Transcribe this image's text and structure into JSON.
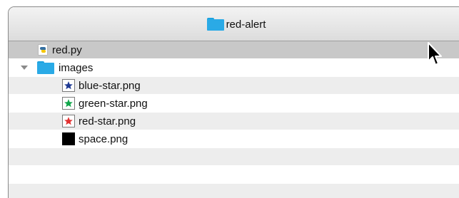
{
  "window": {
    "title": "red-alert"
  },
  "rows": [
    {
      "label": "red.py",
      "icon": "python-file-icon",
      "kind": "file",
      "selected": true
    },
    {
      "label": "images",
      "icon": "folder-icon",
      "kind": "folder",
      "expanded": true
    },
    {
      "label": "blue-star.png",
      "icon": "star-icon",
      "star_color": "#1f3a93"
    },
    {
      "label": "green-star.png",
      "icon": "star-icon",
      "star_color": "#10a64a"
    },
    {
      "label": "red-star.png",
      "icon": "star-icon",
      "star_color": "#e23131"
    },
    {
      "label": "space.png",
      "icon": "black-square-icon",
      "color": "#000000"
    }
  ],
  "colors": {
    "folder": "#2aaae6",
    "selected_row": "#c8c8c8",
    "stripe_row": "#ededed"
  }
}
